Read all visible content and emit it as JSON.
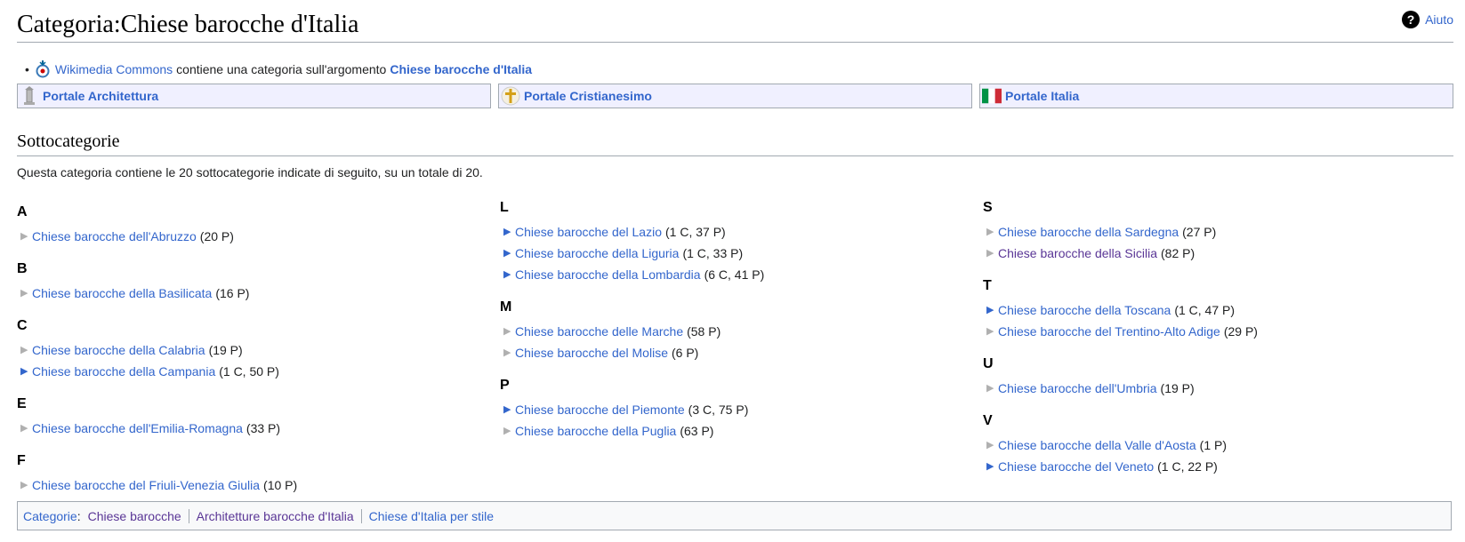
{
  "header": {
    "title": "Categoria:Chiese barocche d'Italia",
    "help_label": "Aiuto"
  },
  "commons": {
    "link": "Wikimedia Commons",
    "text": "contiene una categoria sull'argomento",
    "category": "Chiese barocche d'Italia"
  },
  "portals": [
    {
      "label": "Portale Architettura",
      "icon": "architecture-icon"
    },
    {
      "label": "Portale Cristianesimo",
      "icon": "cross-icon"
    },
    {
      "label": "Portale Italia",
      "icon": "italy-flag-icon"
    }
  ],
  "subcategories": {
    "heading": "Sottocategorie",
    "description": "Questa categoria contiene le 20 sottocategorie indicate di seguito, su un totale di 20.",
    "columns": [
      [
        {
          "letter": "A",
          "items": [
            {
              "label": "Chiese barocche dell'Abruzzo",
              "count": "(20 P)",
              "expandable": false
            }
          ]
        },
        {
          "letter": "B",
          "items": [
            {
              "label": "Chiese barocche della Basilicata",
              "count": "(16 P)",
              "expandable": false
            }
          ]
        },
        {
          "letter": "C",
          "items": [
            {
              "label": "Chiese barocche della Calabria",
              "count": "(19 P)",
              "expandable": false
            },
            {
              "label": "Chiese barocche della Campania",
              "count": "(1 C, 50 P)",
              "expandable": true
            }
          ]
        },
        {
          "letter": "E",
          "items": [
            {
              "label": "Chiese barocche dell'Emilia-Romagna",
              "count": "(33 P)",
              "expandable": false
            }
          ]
        },
        {
          "letter": "F",
          "items": [
            {
              "label": "Chiese barocche del Friuli-Venezia Giulia",
              "count": "(10 P)",
              "expandable": false
            }
          ]
        }
      ],
      [
        {
          "letter": "L",
          "items": [
            {
              "label": "Chiese barocche del Lazio",
              "count": "(1 C, 37 P)",
              "expandable": true
            },
            {
              "label": "Chiese barocche della Liguria",
              "count": "(1 C, 33 P)",
              "expandable": true
            },
            {
              "label": "Chiese barocche della Lombardia",
              "count": "(6 C, 41 P)",
              "expandable": true
            }
          ]
        },
        {
          "letter": "M",
          "items": [
            {
              "label": "Chiese barocche delle Marche",
              "count": "(58 P)",
              "expandable": false
            },
            {
              "label": "Chiese barocche del Molise",
              "count": "(6 P)",
              "expandable": false
            }
          ]
        },
        {
          "letter": "P",
          "items": [
            {
              "label": "Chiese barocche del Piemonte",
              "count": "(3 C, 75 P)",
              "expandable": true
            },
            {
              "label": "Chiese barocche della Puglia",
              "count": "(63 P)",
              "expandable": false
            }
          ]
        }
      ],
      [
        {
          "letter": "S",
          "items": [
            {
              "label": "Chiese barocche della Sardegna",
              "count": "(27 P)",
              "expandable": false
            },
            {
              "label": "Chiese barocche della Sicilia",
              "count": "(82 P)",
              "expandable": false,
              "visited": true
            }
          ]
        },
        {
          "letter": "T",
          "items": [
            {
              "label": "Chiese barocche della Toscana",
              "count": "(1 C, 47 P)",
              "expandable": true
            },
            {
              "label": "Chiese barocche del Trentino-Alto Adige",
              "count": "(29 P)",
              "expandable": false
            }
          ]
        },
        {
          "letter": "U",
          "items": [
            {
              "label": "Chiese barocche dell'Umbria",
              "count": "(19 P)",
              "expandable": false
            }
          ]
        },
        {
          "letter": "V",
          "items": [
            {
              "label": "Chiese barocche della Valle d'Aosta",
              "count": "(1 P)",
              "expandable": false
            },
            {
              "label": "Chiese barocche del Veneto",
              "count": "(1 C, 22 P)",
              "expandable": true
            }
          ]
        }
      ]
    ]
  },
  "catlinks": {
    "label": "Categorie",
    "items": [
      {
        "label": "Chiese barocche",
        "visited": true
      },
      {
        "label": "Architetture barocche d'Italia",
        "visited": true
      },
      {
        "label": "Chiese d'Italia per stile",
        "visited": false
      }
    ]
  },
  "colors": {
    "link": "#3366cc",
    "visited_link": "#5a3696",
    "portal_bg": "#f0f0ff",
    "border": "#a2a9b1"
  }
}
